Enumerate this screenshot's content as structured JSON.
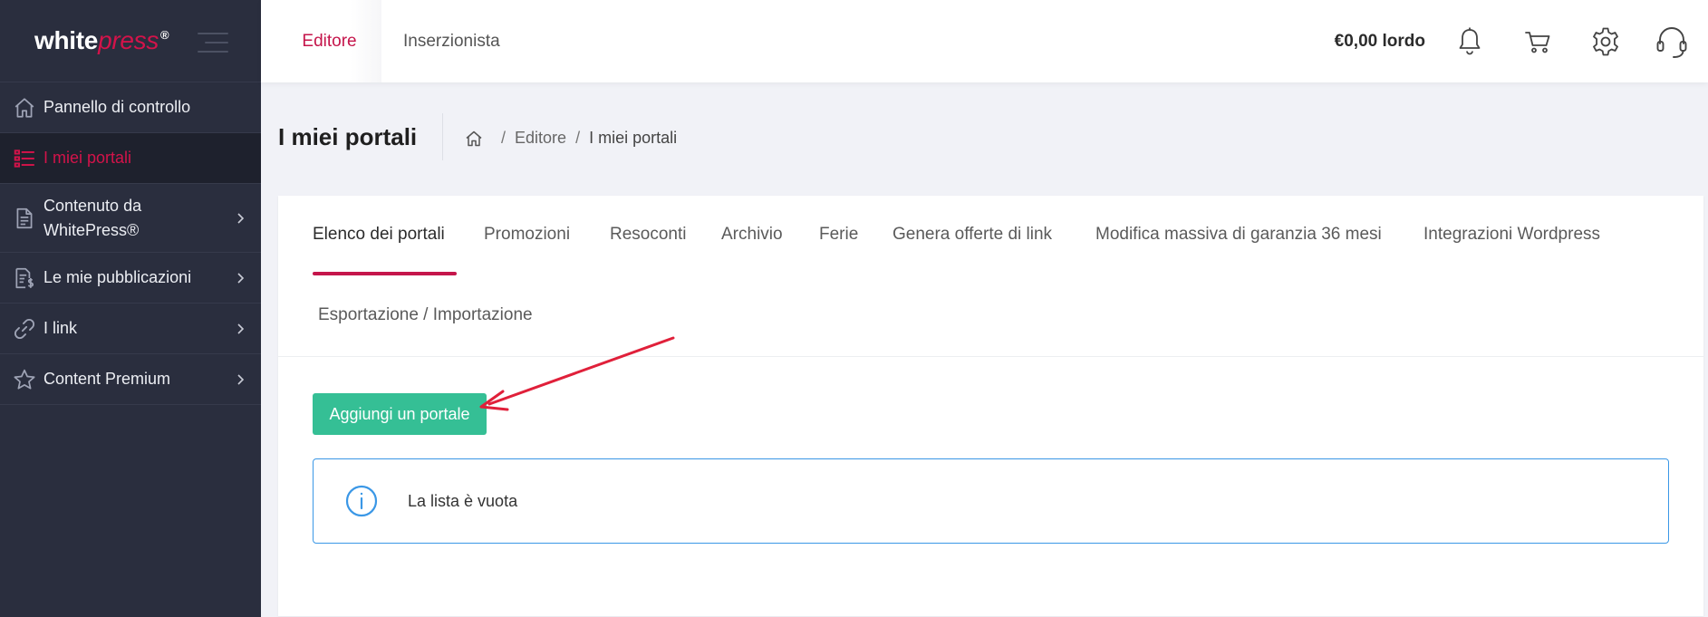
{
  "brand": {
    "word1": "white",
    "word2": "press",
    "mark": "®"
  },
  "sidebar": {
    "items": [
      {
        "label": "Pannello di controllo",
        "icon": "home-icon",
        "has_chevron": false,
        "active": false
      },
      {
        "label": "I miei portali",
        "icon": "list-icon",
        "has_chevron": false,
        "active": true
      },
      {
        "label": "Contenuto da WhitePress®",
        "icon": "document-icon",
        "has_chevron": true,
        "active": false
      },
      {
        "label": "Le mie pubblicazioni",
        "icon": "invoice-icon",
        "has_chevron": true,
        "active": false
      },
      {
        "label": "I link",
        "icon": "link-icon",
        "has_chevron": true,
        "active": false
      },
      {
        "label": "Content Premium",
        "icon": "star-icon",
        "has_chevron": true,
        "active": false
      }
    ]
  },
  "topbar": {
    "tabs": [
      {
        "label": "Editore",
        "active": true
      },
      {
        "label": "Inserzionista",
        "active": false
      }
    ],
    "balance": "€0,00 lordo",
    "icons": [
      "bell-icon",
      "cart-icon",
      "gear-icon",
      "headset-icon"
    ]
  },
  "page": {
    "title": "I miei portali",
    "breadcrumb": {
      "items": [
        "Editore",
        "I miei portali"
      ],
      "separator": "/"
    }
  },
  "tabs": [
    {
      "label": "Elenco dei portali",
      "active": true
    },
    {
      "label": "Promozioni",
      "active": false
    },
    {
      "label": "Resoconti",
      "active": false
    },
    {
      "label": "Archivio",
      "active": false
    },
    {
      "label": "Ferie",
      "active": false
    },
    {
      "label": "Genera offerte di link",
      "active": false
    },
    {
      "label": "Modifica massiva di garanzia 36 mesi",
      "active": false
    },
    {
      "label": "Integrazioni Wordpress",
      "active": false
    },
    {
      "label": "Esportazione / Importazione",
      "active": false
    }
  ],
  "main": {
    "add_button": "Aggiungi un portale",
    "empty_message": "La lista è vuota"
  },
  "colors": {
    "accent": "#c5154b",
    "sidebar_bg": "#2a2e3e",
    "button": "#35bf95",
    "info": "#3a97e6",
    "annotation_arrow": "#e0203a"
  }
}
